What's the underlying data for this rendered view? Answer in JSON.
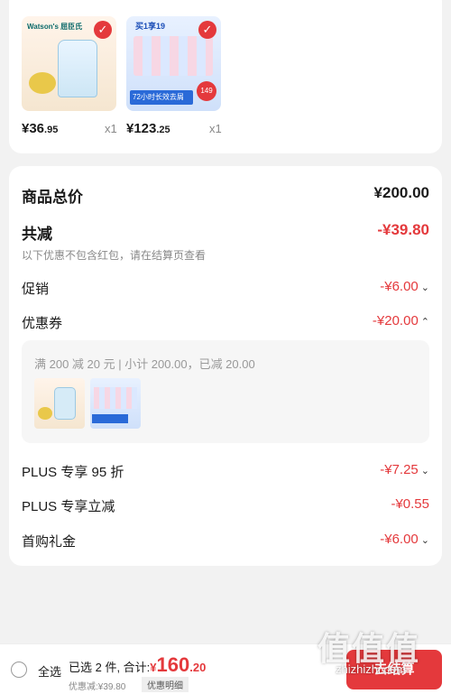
{
  "products": [
    {
      "brand": "Watson's 屈臣氏",
      "price_main": "¥36",
      "price_cents": ".95",
      "qty": "x1"
    },
    {
      "brand": "",
      "promo": "买1享19",
      "badge": "72小时长效去屑",
      "price_main": "¥123",
      "price_cents": ".25",
      "qty": "x1"
    }
  ],
  "summary": {
    "total_label": "商品总价",
    "total_value": "¥200.00",
    "discount_label": "共减",
    "discount_value": "-¥39.80",
    "discount_note": "以下优惠不包含红包，请在结算页查看",
    "promo_label": "促销",
    "promo_value": "-¥6.00",
    "coupon_label": "优惠券",
    "coupon_value": "-¥20.00",
    "coupon_detail": "满 200 减 20 元 | 小计 200.00，已减 20.00",
    "plus95_label": "PLUS 专享 95 折",
    "plus95_value": "-¥7.25",
    "plus_instant_label": "PLUS 专享立减",
    "plus_instant_value": "-¥0.55",
    "first_gift_label": "首购礼金",
    "first_gift_value": "-¥6.00"
  },
  "bottom": {
    "select_all": "全选",
    "selected_text": "已选 2 件, 合计:",
    "total_symbol": "¥",
    "total_main": "160",
    "total_cents": ".20",
    "discount_text": "优惠减:¥39.80",
    "detail_label": "优惠明细",
    "checkout_label": "去结算"
  },
  "watermark": {
    "logo": "值值值",
    "url": "zhizhizhi.com"
  },
  "colors": {
    "accent": "#e4393c",
    "bg": "#f2f2f2"
  }
}
